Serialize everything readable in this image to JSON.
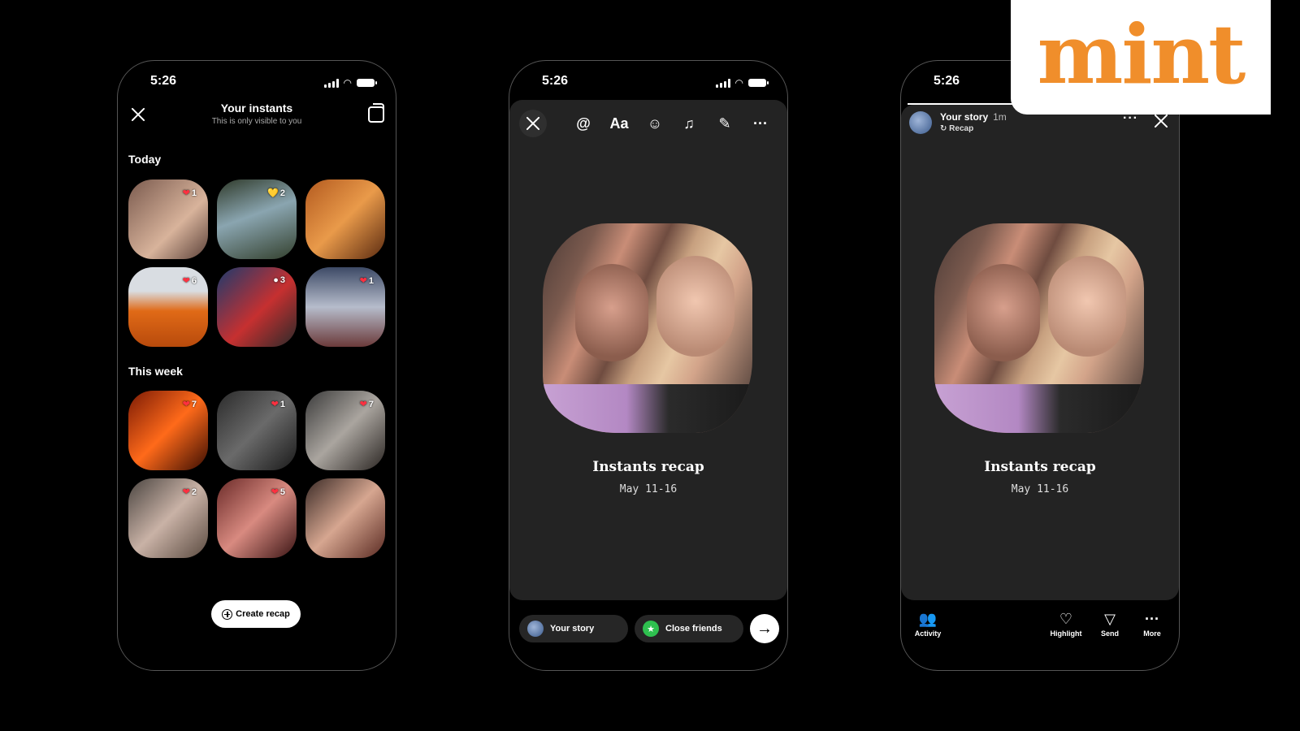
{
  "status": {
    "time": "5:26"
  },
  "phone1": {
    "title": "Your instants",
    "subtitle": "This is only visible to you",
    "sections": [
      {
        "label": "Today",
        "items": [
          {
            "badge_icon": "heart-icon",
            "glyph": "❤",
            "color": "#ff3040",
            "count": "1",
            "bg": "linear-gradient(135deg,#7a5a4e,#d8b39b 60%,#5a4038)"
          },
          {
            "badge_icon": "yellow-heart-icon",
            "glyph": "💛",
            "color": "#ffd21f",
            "count": "2",
            "bg": "linear-gradient(160deg,#2f3a2a,#8aa5b0 45%,#33402d)"
          },
          {
            "badge_icon": "none",
            "glyph": "",
            "color": "#ffffff",
            "count": "",
            "bg": "linear-gradient(135deg,#b35a1f,#e99a4a 50%,#5a2a10)"
          },
          {
            "badge_icon": "heart-icon",
            "glyph": "❤",
            "color": "#ff3040",
            "count": "6",
            "bg": "linear-gradient(180deg,#d9dde2 30%,#e06a17 55%,#b84a0c)"
          },
          {
            "badge_icon": "comment-icon",
            "glyph": "●",
            "color": "#ffffff",
            "count": "3",
            "bg": "linear-gradient(135deg,#1d3b6e,#c63030 55%,#2a2a2a)"
          },
          {
            "badge_icon": "heart-icon",
            "glyph": "❤",
            "color": "#ff3040",
            "count": "1",
            "bg": "linear-gradient(180deg,#3d4a66,#b6bccb 50%,#6b3a3a)"
          }
        ]
      },
      {
        "label": "This week",
        "items": [
          {
            "badge_icon": "heart-icon",
            "glyph": "❤",
            "color": "#ff3040",
            "count": "7",
            "bg": "linear-gradient(135deg,#7a1a05,#ff6a1a 50%,#3a0d02)"
          },
          {
            "badge_icon": "heart-icon",
            "glyph": "❤",
            "color": "#ff3040",
            "count": "1",
            "bg": "linear-gradient(135deg,#2a2a2a,#6a6a6a 50%,#1a1a1a)"
          },
          {
            "badge_icon": "heart-icon",
            "glyph": "❤",
            "color": "#ff3040",
            "count": "7",
            "bg": "linear-gradient(135deg,#3a3a3a,#aaa59f 50%,#2a2522)"
          },
          {
            "badge_icon": "heart-icon",
            "glyph": "❤",
            "color": "#ff3040",
            "count": "2",
            "bg": "linear-gradient(135deg,#4a4440,#c9b2a6 50%,#5a4a40)"
          },
          {
            "badge_icon": "heart-icon",
            "glyph": "❤",
            "color": "#ff3040",
            "count": "5",
            "bg": "linear-gradient(135deg,#6a2a28,#d88a80 50%,#3a1414)"
          },
          {
            "badge_icon": "none",
            "glyph": "",
            "color": "#ffffff",
            "count": "",
            "bg": "linear-gradient(135deg,#3a2a26,#d6a690 50%,#5a2a22)"
          }
        ]
      }
    ],
    "create_recap": "Create recap"
  },
  "phone2": {
    "tools": [
      "at-mention-icon",
      "text-icon",
      "sticker-icon",
      "music-icon",
      "draw-icon",
      "more-icon"
    ],
    "text_tool": "Aa",
    "recap_title": "Instants recap",
    "recap_date": "May 11-16",
    "your_story": "Your story",
    "close_friends": "Close friends"
  },
  "phone3": {
    "story_name": "Your story",
    "story_time": "1m",
    "recap_tag": "Recap",
    "recap_title": "Instants recap",
    "recap_date": "May 11-16",
    "actions": {
      "activity": "Activity",
      "highlight": "Highlight",
      "send": "Send",
      "more": "More"
    }
  },
  "logo": {
    "text": "mint",
    "color": "#f08e2b"
  }
}
